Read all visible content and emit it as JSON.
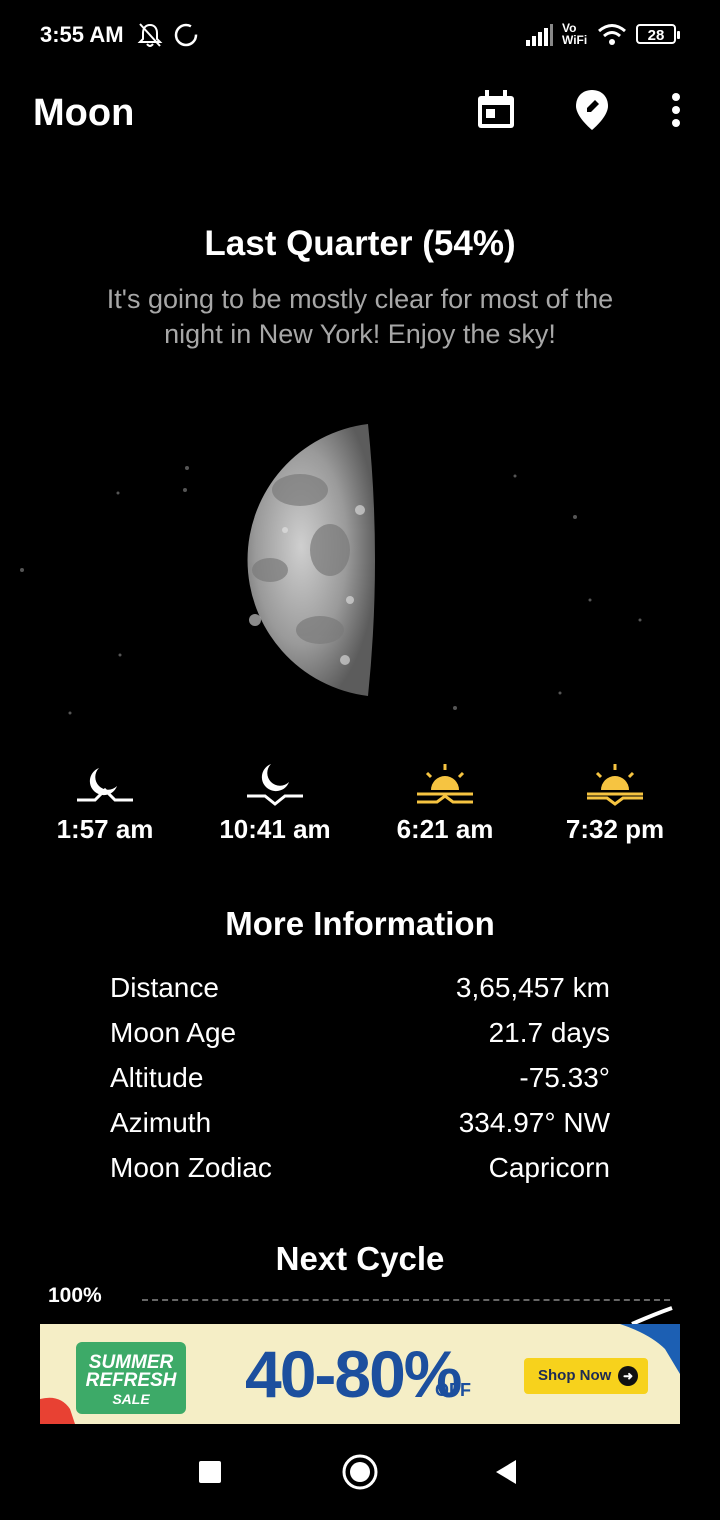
{
  "status_bar": {
    "time": "3:55 AM",
    "network_label": "Vo WiFi",
    "battery": "28"
  },
  "app_bar": {
    "title": "Moon",
    "icons": [
      "calendar-icon",
      "location-edit-icon",
      "more-vert-icon"
    ]
  },
  "phase": {
    "title": "Last Quarter (54%)",
    "description": "It's going to be mostly clear for most of the night in New York! Enjoy the sky!"
  },
  "times": [
    {
      "icon": "moonrise-icon",
      "value": "1:57 am"
    },
    {
      "icon": "moonset-icon",
      "value": "10:41 am"
    },
    {
      "icon": "sunrise-icon",
      "value": "6:21 am"
    },
    {
      "icon": "sunset-icon",
      "value": "7:32 pm"
    }
  ],
  "more_info": {
    "title": "More Information",
    "rows": [
      {
        "label": "Distance",
        "value": "3,65,457 km"
      },
      {
        "label": "Moon Age",
        "value": "21.7 days"
      },
      {
        "label": "Altitude",
        "value": "-75.33°"
      },
      {
        "label": "Azimuth",
        "value": "334.97° NW"
      },
      {
        "label": "Moon Zodiac",
        "value": "Capricorn"
      }
    ]
  },
  "next_cycle": {
    "title": "Next Cycle",
    "axis_label": "100%"
  },
  "ad": {
    "badge_line1": "SUMMER",
    "badge_line2": "REFRESH",
    "badge_line3": "SALE",
    "headline": "40-80%",
    "off": "OFF",
    "cta": "Shop Now"
  },
  "colors": {
    "background": "#000000",
    "subtitle_gray": "#a7a7a7",
    "sun_yellow": "#f6c441"
  }
}
